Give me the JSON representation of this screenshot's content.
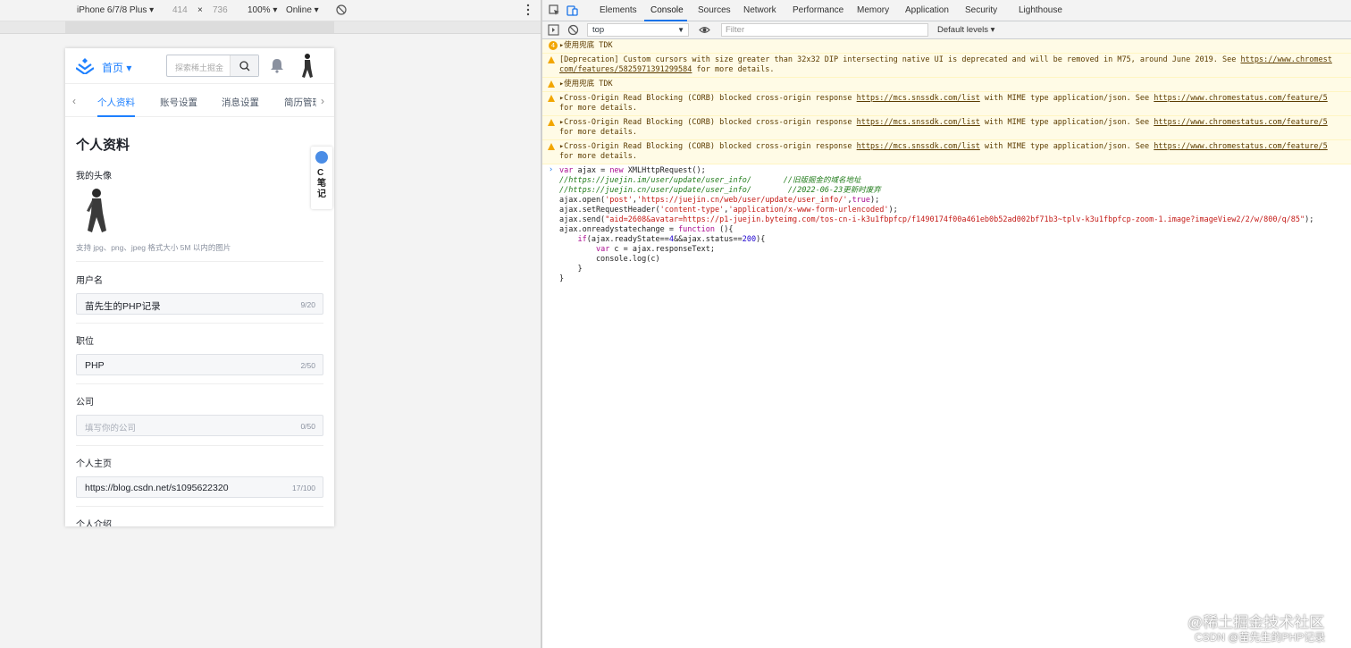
{
  "device_toolbar": {
    "device": "iPhone 6/7/8 Plus",
    "width": "414",
    "times": "×",
    "height": "736",
    "zoom": "100%",
    "throttle": "Online"
  },
  "app": {
    "home_label": "首页",
    "search_placeholder": "探索稀土掘金",
    "tabs": [
      "个人资料",
      "账号设置",
      "消息设置",
      "简历管理"
    ],
    "section_title": "个人资料",
    "avatar_label": "我的头像",
    "avatar_hint": "支持 jpg、png、jpeg 格式大小 5M 以内的图片",
    "fields": [
      {
        "label": "用户名",
        "value": "苗先生的PHP记录",
        "count": "9/20",
        "placeholder": false
      },
      {
        "label": "职位",
        "value": "PHP",
        "count": "2/50",
        "placeholder": false
      },
      {
        "label": "公司",
        "value": "填写你的公司",
        "count": "0/50",
        "placeholder": true
      },
      {
        "label": "个人主页",
        "value": "https://blog.csdn.net/s1095622320",
        "count": "17/100",
        "placeholder": false
      }
    ],
    "intro_label": "个人介绍",
    "side_note": {
      "line1": "C",
      "line2": "笔",
      "line3": "记"
    }
  },
  "devtools": {
    "tabs": [
      "Elements",
      "Console",
      "Sources",
      "Network",
      "Performance",
      "Memory",
      "Application",
      "Security",
      "Lighthouse"
    ],
    "active_tab": "Console",
    "context": "top",
    "filter_placeholder": "Filter",
    "levels": "Default levels ▾",
    "messages": [
      {
        "badge": "4",
        "text": "▸使用兜底 TDK"
      },
      {
        "text": "[Deprecation] Custom cursors with size greater than 32x32 DIP intersecting native UI is deprecated and will be removed in M75, around June 2019. See ",
        "link": "https://www.chromest",
        "text2": "",
        "line2_link": "com/features/5825971391299584",
        "line2": " for more details."
      },
      {
        "text": "▸使用兜底 TDK"
      },
      {
        "text": "▸Cross-Origin Read Blocking (CORB) blocked cross-origin response ",
        "link": "https://mcs.snssdk.com/list",
        "text2": " with MIME type application/json. See ",
        "link2": "https://www.chromestatus.com/feature/5",
        "line2": "for more details."
      },
      {
        "text": "▸Cross-Origin Read Blocking (CORB) blocked cross-origin response ",
        "link": "https://mcs.snssdk.com/list",
        "text2": " with MIME type application/json. See ",
        "link2": "https://www.chromestatus.com/feature/5",
        "line2": "for more details."
      },
      {
        "text": "▸Cross-Origin Read Blocking (CORB) blocked cross-origin response ",
        "link": "https://mcs.snssdk.com/list",
        "text2": " with MIME type application/json. See ",
        "link2": "https://www.chromestatus.com/feature/5",
        "line2": "for more details."
      }
    ],
    "code": {
      "l1a": "var",
      "l1b": " ajax = ",
      "l1c": "new",
      "l1d": " XMLHttpRequest();",
      "l2a": "//https://juejin.im/user/update/user_info/",
      "l2b": "       //旧版掘金的域名地址",
      "l3a": "//https://juejin.cn/user/update/user_info/",
      "l3b": "        //2022-06-23更新时废弃",
      "l4a": "ajax.open(",
      "l4b": "'post'",
      "l4c": ",",
      "l4d": "'https://juejin.cn/web/user/update/user_info/'",
      "l4e": ",",
      "l4f": "true",
      "l4g": ");",
      "l5a": "ajax.setRequestHeader(",
      "l5b": "'content-type'",
      "l5c": ",",
      "l5d": "'application/x-www-form-urlencoded'",
      "l5e": ");",
      "l6a": "ajax.send(",
      "l6b": "\"aid=2608&avatar=https://p1-juejin.byteimg.com/tos-cn-i-k3u1fbpfcp/f1490174f00a461eb0b52ad002bf71b3~tplv-k3u1fbpfcp-zoom-1.image?imageView2/2/w/800/q/85\"",
      "l6c": ");",
      "l7a": "ajax.onreadystatechange = ",
      "l7b": "function",
      "l7c": " (){",
      "l8a": "    ",
      "l8b": "if",
      "l8c": "(ajax.readyState==",
      "l8d": "4",
      "l8e": "&&ajax.status==",
      "l8f": "200",
      "l8g": "){",
      "l9a": "        ",
      "l9b": "var",
      "l9c": " c = ajax.responseText;",
      "l10": "        console.log(c)",
      "l11": "    }",
      "l12": "}"
    }
  },
  "watermark": {
    "line1": "@稀土掘金技术社区",
    "line2": "CSDN @苗先生的PHP记录"
  }
}
